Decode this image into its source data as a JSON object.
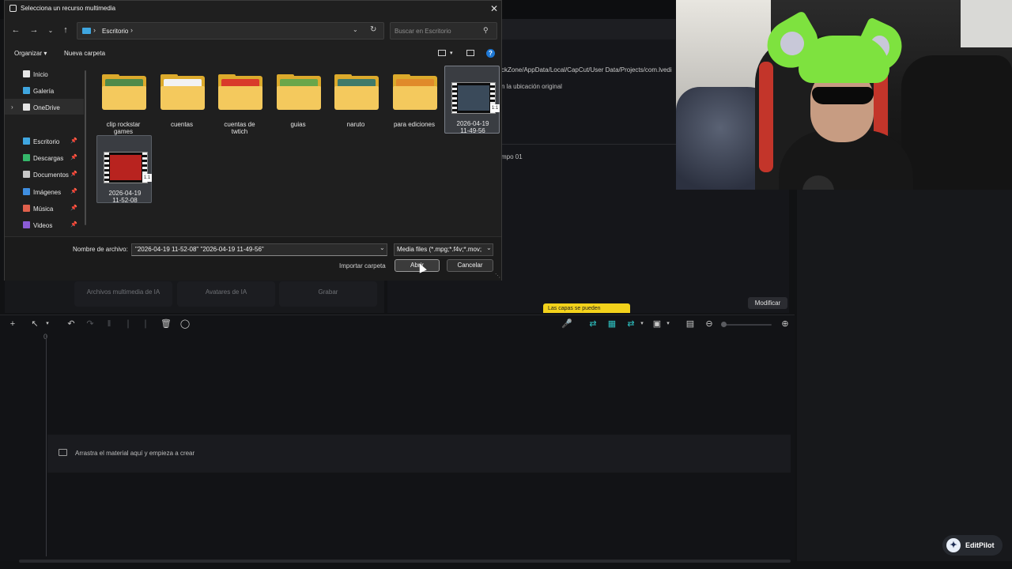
{
  "dialog": {
    "title": "Selecciona un recurso multimedia",
    "address": {
      "location": "Escritorio"
    },
    "search_placeholder": "Buscar en Escritorio",
    "toolbar": {
      "organize": "Organizar",
      "new_folder": "Nueva carpeta"
    },
    "sidebar": [
      {
        "label": "Inicio",
        "icon": "home-icon",
        "color": "#e6e6e6"
      },
      {
        "label": "Galería",
        "icon": "gallery-icon",
        "color": "#3fa6e0"
      },
      {
        "label": "OneDrive",
        "icon": "onedrive-icon",
        "color": "#e6e6e6",
        "selected": true
      },
      {
        "label": "Escritorio",
        "icon": "desktop-icon",
        "color": "#3fa6e0",
        "pinned": true
      },
      {
        "label": "Descargas",
        "icon": "download-icon",
        "color": "#35b86b",
        "pinned": true
      },
      {
        "label": "Documentos",
        "icon": "documents-icon",
        "color": "#c8c8c8",
        "pinned": true
      },
      {
        "label": "Imágenes",
        "icon": "images-icon",
        "color": "#3f8ee0",
        "pinned": true
      },
      {
        "label": "Música",
        "icon": "music-icon",
        "color": "#e0604c",
        "pinned": true
      },
      {
        "label": "Videos",
        "icon": "videos-icon",
        "color": "#8b5cd6",
        "pinned": true
      }
    ],
    "files": [
      {
        "line1": "clip rockstar",
        "line2": "games",
        "type": "folder",
        "preview": "#4f8a4a"
      },
      {
        "line1": "cuentas",
        "line2": "",
        "type": "folder",
        "preview": "#f2f2f2"
      },
      {
        "line1": "cuentas de",
        "line2": "twtich",
        "type": "folder",
        "preview": "#d93a2a"
      },
      {
        "line1": "guias",
        "line2": "",
        "type": "folder",
        "preview": "#6aa64a"
      },
      {
        "line1": "naruto",
        "line2": "",
        "type": "folder",
        "preview": "#3f7a6a"
      },
      {
        "line1": "para ediciones",
        "line2": "",
        "type": "folder",
        "preview": "#e08a2a"
      },
      {
        "line1": "2026-04-19",
        "line2": "11-49-56",
        "type": "video",
        "preview": "#3a4a5a",
        "selected": true
      },
      {
        "line1": "2026-04-19",
        "line2": "11-52-08",
        "type": "video",
        "preview": "#b8231f",
        "selected": true
      }
    ],
    "video_badge": "1:1",
    "filename_label": "Nombre de archivo:",
    "filename_value": "\"2026-04-19 11-52-08\" \"2026-04-19 11-49-56\"",
    "filetype_value": "Media files (*.mpg;*.f4v;*.mov;",
    "import_folder": "Importar carpeta",
    "open_button": "Abrir",
    "cancel_button": "Cancelar"
  },
  "editor": {
    "tiles": [
      "Archivos multimedia de IA",
      "Avatares de IA",
      "Grabar"
    ],
    "path_text": "ckZone/AppData/Local/CapCut/User Data/Projects/com.lvedi",
    "original_text": "n la ubicación original",
    "tiempo_text": "mpo 01",
    "tooltip_text": "Las capas se pueden",
    "modify_button": "Modificar",
    "timeline_zero": "0",
    "drop_text": "Arrastra el material aquí y empieza a crear",
    "editpilot_label": "EditPilot"
  },
  "colors": {
    "accent_teal": "#2ec4c4",
    "help_blue": "#1e78d4",
    "tooltip_yellow": "#f3d21b",
    "webcam_hat_green": "#7ee23f"
  }
}
